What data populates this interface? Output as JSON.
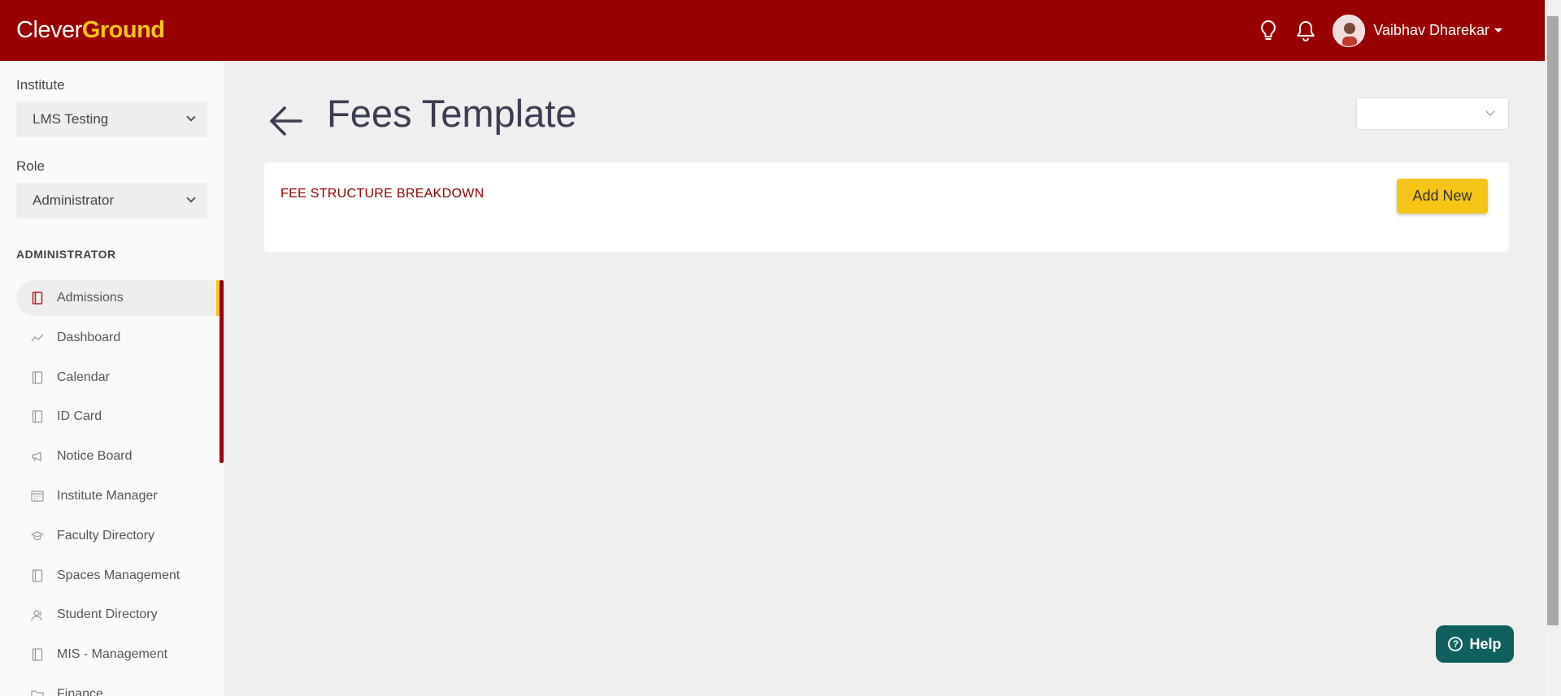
{
  "header": {
    "logo_part1": "Clever",
    "logo_part2": "Ground",
    "user_name": "Vaibhav Dharekar",
    "brand_color": "#990000",
    "accent_color": "#f5c518"
  },
  "sidebar": {
    "institute_label": "Institute",
    "institute_value": "LMS Testing",
    "role_label": "Role",
    "role_value": "Administrator",
    "section_title": "ADMINISTRATOR",
    "items": [
      {
        "label": "Admissions",
        "icon": "book-icon",
        "active": true
      },
      {
        "label": "Dashboard",
        "icon": "trend-icon"
      },
      {
        "label": "Calendar",
        "icon": "book-icon"
      },
      {
        "label": "ID Card",
        "icon": "book-icon"
      },
      {
        "label": "Notice Board",
        "icon": "megaphone-icon"
      },
      {
        "label": "Institute Manager",
        "icon": "calendar-grid-icon"
      },
      {
        "label": "Faculty Directory",
        "icon": "graduation-cap-icon"
      },
      {
        "label": "Spaces Management",
        "icon": "book-icon"
      },
      {
        "label": "Student Directory",
        "icon": "users-icon"
      },
      {
        "label": "MIS - Management",
        "icon": "book-icon"
      },
      {
        "label": "Finance",
        "icon": "folder-icon"
      }
    ]
  },
  "main": {
    "page_title": "Fees Template",
    "card_title": "FEE STRUCTURE BREAKDOWN",
    "add_button": "Add New"
  },
  "help": {
    "label": "Help"
  }
}
